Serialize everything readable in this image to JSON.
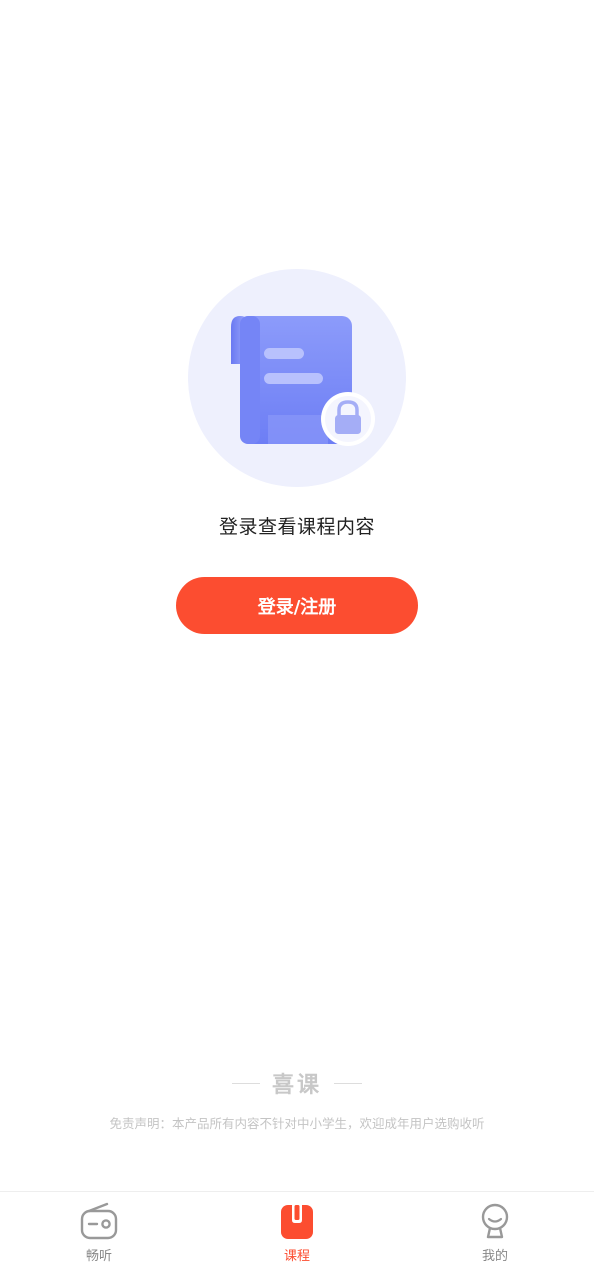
{
  "main": {
    "prompt": "登录查看课程内容",
    "login_button_label": "登录/注册"
  },
  "footer": {
    "brand": "喜课",
    "disclaimer": "免责声明：本产品所有内容不针对中小学生，欢迎成年用户选购收听"
  },
  "tabbar": {
    "tabs": [
      {
        "label": "畅听",
        "icon": "radio-icon",
        "active": false
      },
      {
        "label": "课程",
        "icon": "course-book-icon",
        "active": true
      },
      {
        "label": "我的",
        "icon": "profile-icon",
        "active": false
      }
    ]
  },
  "colors": {
    "accent": "#fc4d30",
    "illustration_bg": "#eef0fd",
    "illustration_doc": "#7d8cf8",
    "inactive": "#888888"
  }
}
